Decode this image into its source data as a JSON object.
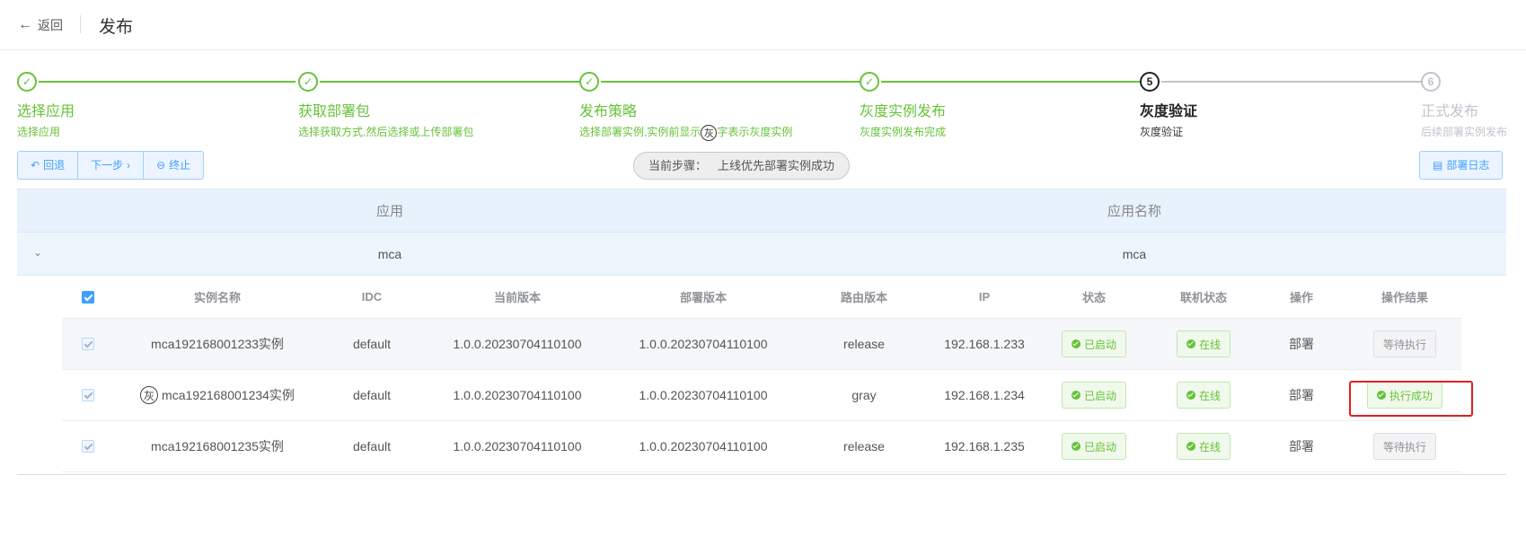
{
  "header": {
    "back_label": "返回",
    "title": "发布"
  },
  "steps": [
    {
      "title": "选择应用",
      "desc": "选择应用",
      "state": "done"
    },
    {
      "title": "获取部署包",
      "desc": "选择获取方式,然后选择或上传部署包",
      "state": "done"
    },
    {
      "title": "发布策略",
      "desc_before": "选择部署实例,实例前显示",
      "desc_badge": "灰",
      "desc_after": "字表示灰度实例",
      "state": "done"
    },
    {
      "title": "灰度实例发布",
      "desc": "灰度实例发布完成",
      "state": "done"
    },
    {
      "title": "灰度验证",
      "desc": "灰度验证",
      "number": "5",
      "state": "active"
    },
    {
      "title": "正式发布",
      "desc": "后续部署实例发布",
      "number": "6",
      "state": "wait"
    }
  ],
  "toolbar": {
    "rollback": "回退",
    "next": "下一步",
    "stop": "终止",
    "current_step_label": "当前步骤：",
    "current_step_value": "上线优先部署实例成功",
    "log": "部署日志"
  },
  "outer_table": {
    "headers": [
      "应用",
      "应用名称"
    ],
    "row": [
      "mca",
      "mca"
    ]
  },
  "inner_table": {
    "headers": [
      "实例名称",
      "IDC",
      "当前版本",
      "部署版本",
      "路由版本",
      "IP",
      "状态",
      "联机状态",
      "操作",
      "操作结果"
    ],
    "rows": [
      {
        "name": "mca192168001233实例",
        "gray": false,
        "idc": "default",
        "current": "1.0.0.20230704110100",
        "deploy": "1.0.0.20230704110100",
        "route": "release",
        "ip": "192.168.1.233",
        "status": "已启动",
        "online": "在线",
        "op": "部署",
        "result": "等待执行",
        "result_type": "wait"
      },
      {
        "name": "mca192168001234实例",
        "gray": true,
        "gray_badge": "灰",
        "idc": "default",
        "current": "1.0.0.20230704110100",
        "deploy": "1.0.0.20230704110100",
        "route": "gray",
        "ip": "192.168.1.234",
        "status": "已启动",
        "online": "在线",
        "op": "部署",
        "result": "执行成功",
        "result_type": "success"
      },
      {
        "name": "mca192168001235实例",
        "gray": false,
        "idc": "default",
        "current": "1.0.0.20230704110100",
        "deploy": "1.0.0.20230704110100",
        "route": "release",
        "ip": "192.168.1.235",
        "status": "已启动",
        "online": "在线",
        "op": "部署",
        "result": "等待执行",
        "result_type": "wait"
      }
    ]
  },
  "colors": {
    "success": "#67c23a",
    "primary": "#409eff",
    "highlight": "#e02020"
  }
}
